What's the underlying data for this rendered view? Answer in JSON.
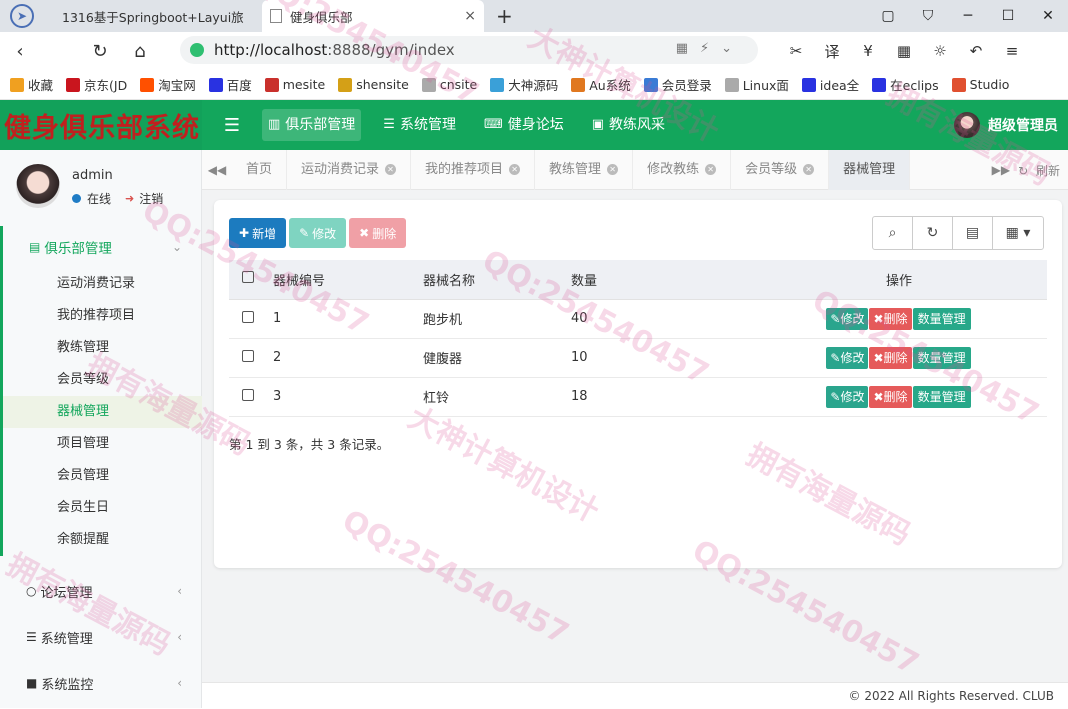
{
  "browser": {
    "tabs": [
      {
        "title": "1316基于Springboot+Layui旅"
      },
      {
        "title": "健身俱乐部",
        "close": "×"
      }
    ],
    "new_tab": "+",
    "url_host": "http://localhost",
    "url_rest": ":8888/gym/index",
    "bookmarks": [
      {
        "label": "收藏",
        "color": "#f0a020"
      },
      {
        "label": "京东(JD",
        "color": "#c9151e"
      },
      {
        "label": "淘宝网",
        "color": "#ff5000"
      },
      {
        "label": "百度",
        "color": "#2932e1"
      },
      {
        "label": "mesite",
        "color": "#c9302c"
      },
      {
        "label": "shensite",
        "color": "#d4a017"
      },
      {
        "label": "cnsite",
        "color": "#aaaaaa"
      },
      {
        "label": "大神源码",
        "color": "#3aa0d8"
      },
      {
        "label": "Au系统",
        "color": "#e07820"
      },
      {
        "label": "会员登录",
        "color": "#3a7bd5"
      },
      {
        "label": "Linux面",
        "color": "#aaaaaa"
      },
      {
        "label": "idea全",
        "color": "#2932e1"
      },
      {
        "label": "在eclips",
        "color": "#2932e1"
      },
      {
        "label": "Studio",
        "color": "#e05030"
      }
    ]
  },
  "app": {
    "brand": "健身俱乐部系统",
    "topnav": [
      {
        "label": "俱乐部管理",
        "icon": "bar-chart-icon",
        "active": true
      },
      {
        "label": "系统管理",
        "icon": "list-icon"
      },
      {
        "label": "健身论坛",
        "icon": "keyboard-icon"
      },
      {
        "label": "教练风采",
        "icon": "image-icon"
      }
    ],
    "header_user": "超级管理员"
  },
  "sidebar": {
    "user": {
      "name": "admin",
      "status": "在线",
      "logout": "注销"
    },
    "group": {
      "label": "俱乐部管理",
      "items": [
        "运动消费记录",
        "我的推荐项目",
        "教练管理",
        "会员等级",
        "器械管理",
        "项目管理",
        "会员管理",
        "会员生日",
        "余额提醒"
      ],
      "active_index": 4
    },
    "others": [
      {
        "label": "论坛管理",
        "icon": "circle-icon"
      },
      {
        "label": "系统管理",
        "icon": "bars-icon"
      },
      {
        "label": "系统监控",
        "icon": "video-icon"
      }
    ]
  },
  "page_tabs": {
    "items": [
      "首页",
      "运动消费记录",
      "我的推荐项目",
      "教练管理",
      "修改教练",
      "会员等级",
      "器械管理"
    ],
    "active_index": 6,
    "refresh": "刷新"
  },
  "toolbar": {
    "add": "新增",
    "edit": "修改",
    "delete": "删除"
  },
  "table": {
    "headers": [
      "器械编号",
      "器械名称",
      "数量",
      "操作"
    ],
    "rows": [
      {
        "id": "1",
        "name": "跑步机",
        "qty": "40"
      },
      {
        "id": "2",
        "name": "健腹器",
        "qty": "10"
      },
      {
        "id": "3",
        "name": "杠铃",
        "qty": "18"
      }
    ],
    "row_actions": {
      "edit": "修改",
      "delete": "删除",
      "qty": "数量管理"
    }
  },
  "pagination": "第 1 到 3 条，共 3 条记录。",
  "footer": "© 2022 All Rights Reserved. CLUB",
  "watermarks": [
    "QQ:254540457",
    "拥有海量源码",
    "大神计算机设计"
  ]
}
